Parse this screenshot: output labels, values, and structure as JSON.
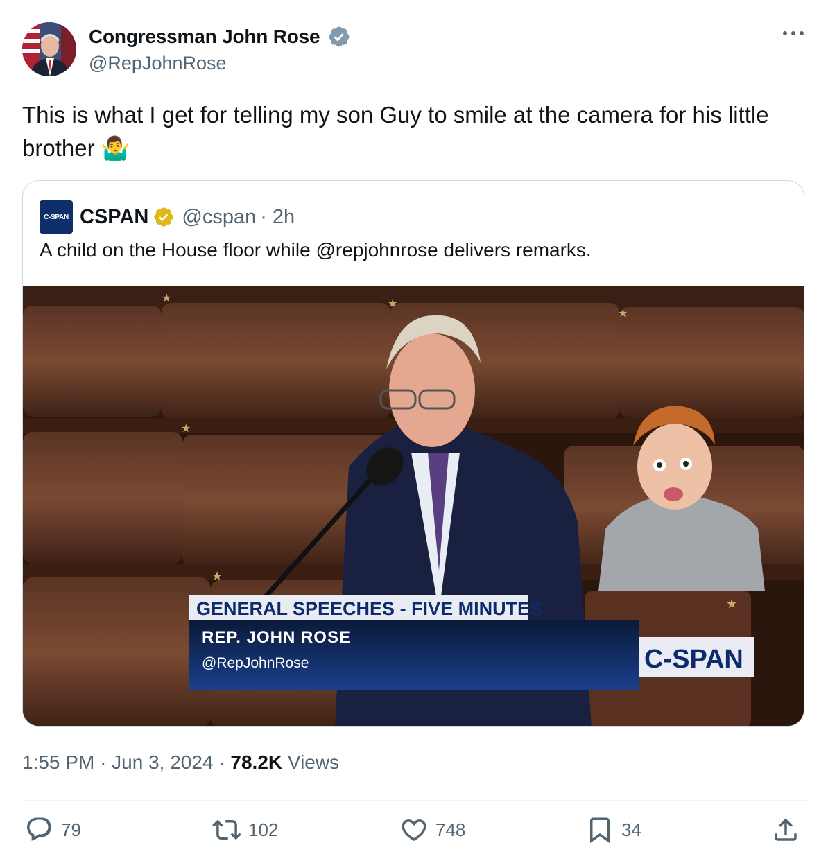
{
  "author": {
    "display_name": "Congressman John Rose",
    "handle": "@RepJohnRose"
  },
  "tweet": {
    "text": "This is what I get for telling my son Guy to smile at the camera for his little brother",
    "emoji": "🤷‍♂️"
  },
  "quote": {
    "logo_text": "C-SPAN",
    "display_name": "CSPAN",
    "handle": "@cspan",
    "time": "· 2h",
    "text": "A child on the House floor while @repjohnrose delivers remarks.",
    "video": {
      "lower_third_title": "GENERAL SPEECHES - FIVE MINUTES",
      "speaker": "REP. JOHN ROSE",
      "speaker_handle": "@RepJohnRose",
      "bug": "C-SPAN"
    }
  },
  "meta": {
    "time": "1:55 PM",
    "date": "Jun 3, 2024",
    "views_count": "78.2K",
    "views_label": "Views"
  },
  "actions": {
    "replies": "79",
    "reposts": "102",
    "likes": "748",
    "bookmarks": "34"
  },
  "colors": {
    "verified_blue": "#829aab",
    "verified_gold": "#e2b719",
    "cspan_navy": "#0e2e6b",
    "muted_text": "#536471"
  }
}
